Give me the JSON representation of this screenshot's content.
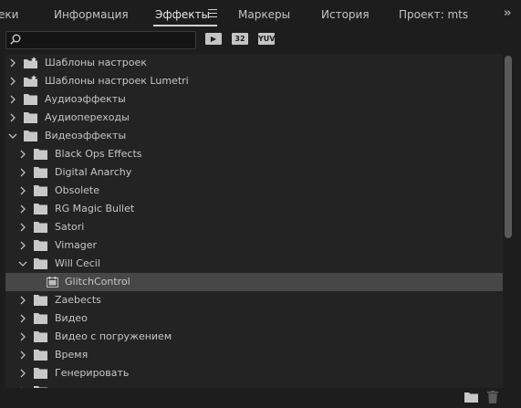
{
  "tabs": [
    {
      "label": "еки",
      "active": false
    },
    {
      "label": "Информация",
      "active": false
    },
    {
      "label": "Эффекты",
      "active": true
    },
    {
      "label": "Маркеры",
      "active": false
    },
    {
      "label": "История",
      "active": false
    },
    {
      "label": "Проект: mts",
      "active": false
    }
  ],
  "search": {
    "value": "",
    "placeholder": ""
  },
  "filters": [
    "accelerated-effects-icon",
    "32-bit-icon",
    "yuv-icon"
  ],
  "filter_labels": {
    "accel": "▶",
    "bit32": "32",
    "yuv": "YUV"
  },
  "tree": [
    {
      "label": "Шаблоны настроек",
      "level": 0,
      "expanded": false,
      "icon": "preset-bin-icon"
    },
    {
      "label": "Шаблоны настроек Lumetri",
      "level": 0,
      "expanded": false,
      "icon": "preset-bin-icon"
    },
    {
      "label": "Аудиоэффекты",
      "level": 0,
      "expanded": false,
      "icon": "folder-icon"
    },
    {
      "label": "Аудиопереходы",
      "level": 0,
      "expanded": false,
      "icon": "folder-icon"
    },
    {
      "label": "Видеоэффекты",
      "level": 0,
      "expanded": true,
      "icon": "folder-icon"
    },
    {
      "label": "Black Ops Effects",
      "level": 1,
      "expanded": false,
      "icon": "folder-icon"
    },
    {
      "label": "Digital Anarchy",
      "level": 1,
      "expanded": false,
      "icon": "folder-icon"
    },
    {
      "label": "Obsolete",
      "level": 1,
      "expanded": false,
      "icon": "folder-icon"
    },
    {
      "label": "RG Magic Bullet",
      "level": 1,
      "expanded": false,
      "icon": "folder-icon"
    },
    {
      "label": "Satori",
      "level": 1,
      "expanded": false,
      "icon": "folder-icon"
    },
    {
      "label": "Vimager",
      "level": 1,
      "expanded": false,
      "icon": "folder-icon"
    },
    {
      "label": "Will Cecil",
      "level": 1,
      "expanded": true,
      "icon": "folder-icon"
    },
    {
      "label": "GlitchControl",
      "level": 2,
      "expanded": null,
      "icon": "effect-icon",
      "selected": true
    },
    {
      "label": "Zaebects",
      "level": 1,
      "expanded": false,
      "icon": "folder-icon"
    },
    {
      "label": "Видео",
      "level": 1,
      "expanded": false,
      "icon": "folder-icon"
    },
    {
      "label": "Видео с погружением",
      "level": 1,
      "expanded": false,
      "icon": "folder-icon"
    },
    {
      "label": "Время",
      "level": 1,
      "expanded": false,
      "icon": "folder-icon"
    },
    {
      "label": "Генерировать",
      "level": 1,
      "expanded": false,
      "icon": "folder-icon"
    },
    {
      "label": "",
      "level": 1,
      "expanded": false,
      "icon": "folder-icon"
    }
  ],
  "footer": {
    "icons": [
      "new-bin-icon",
      "trash-icon"
    ]
  },
  "colors": {
    "background": "#1d1d1d",
    "list_bg": "#232323",
    "selected_row": "#474747",
    "text": "#c6c6c6"
  }
}
